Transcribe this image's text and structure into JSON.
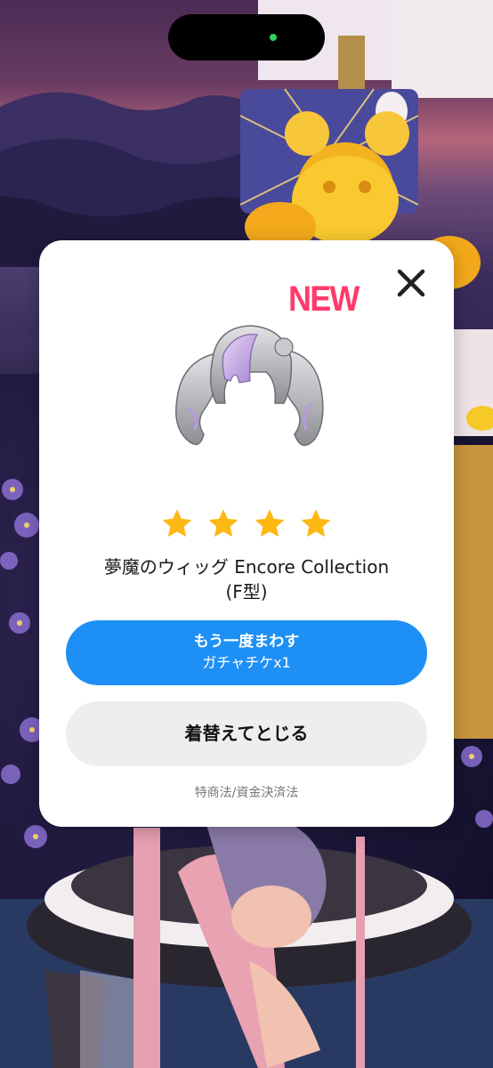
{
  "status_bar": {
    "camera_indicator_color": "#2fd35b"
  },
  "modal": {
    "new_badge": "NEW",
    "close_icon": "close-icon",
    "item_image_icon": "twin-tail-wig-icon",
    "rarity_stars": 4,
    "star_color": "#fdb813",
    "item_name_line1": "夢魔のウィッグ Encore Collection",
    "item_name_line2": "(F型)",
    "spin_again_button": {
      "label": "もう一度まわす",
      "cost": "ガチャチケx1",
      "color": "#1e90f5"
    },
    "change_clothes_button": {
      "label": "着替えてとじる"
    },
    "legal_link": "特商法/資金決済法"
  }
}
